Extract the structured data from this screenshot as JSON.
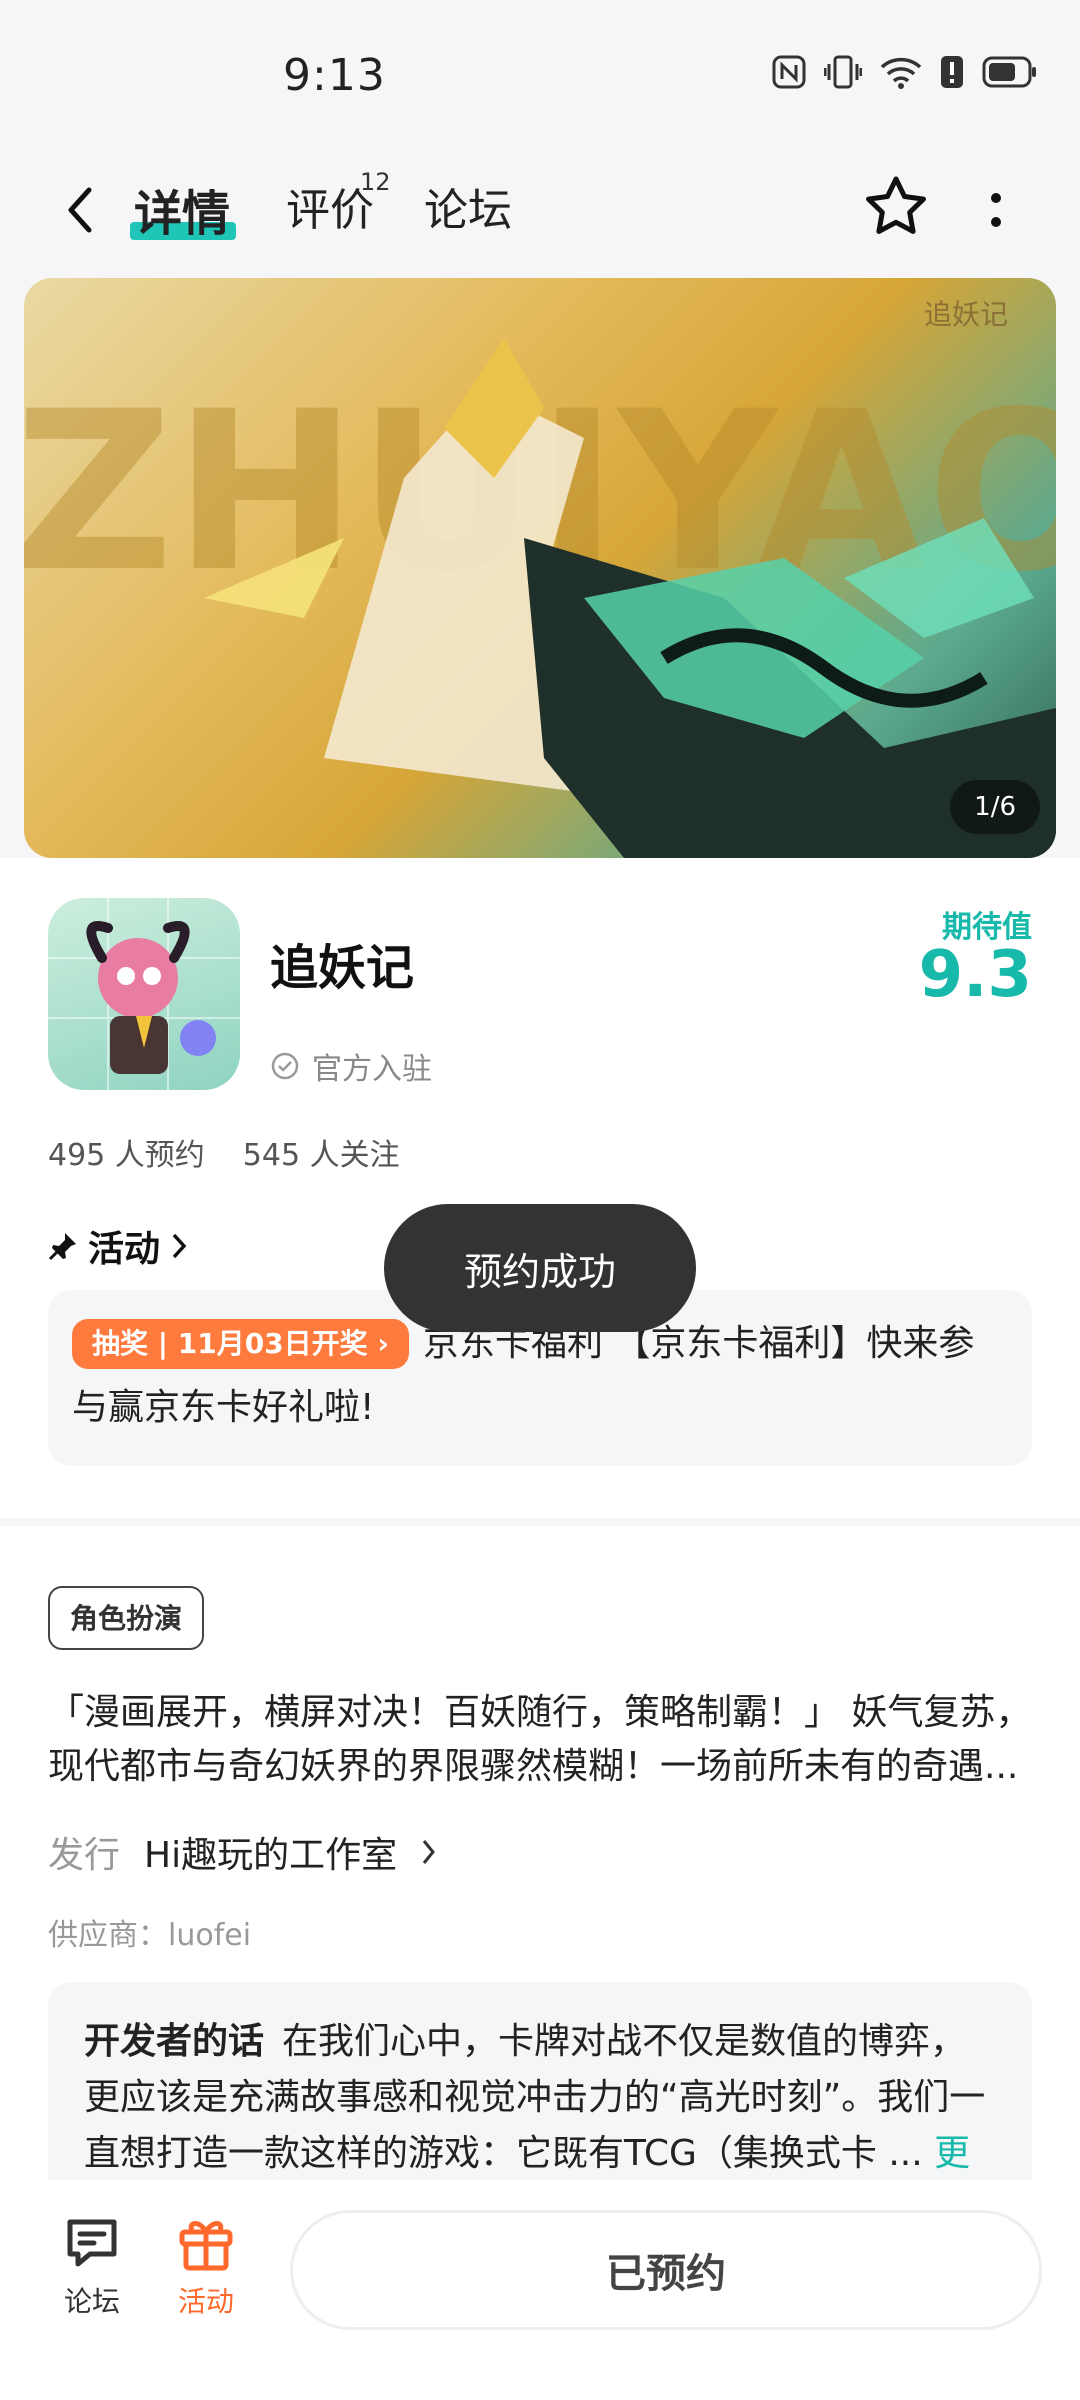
{
  "status_bar": {
    "time": "9:13"
  },
  "header": {
    "tabs": [
      {
        "label": "详情"
      },
      {
        "label": "评价",
        "badge": "12"
      },
      {
        "label": "论坛"
      }
    ]
  },
  "banner": {
    "counter": "1/6",
    "watermark": "ZHUIYAOJI",
    "corner_logo": "追妖记"
  },
  "app": {
    "name": "追妖记",
    "official_label": "官方入驻",
    "score_label": "期待值",
    "score": "9.3",
    "reservations": "495 人预约",
    "followers": "545 人关注"
  },
  "activity": {
    "heading": "活动",
    "tag": "抽奖 | 11月03日开奖",
    "text": "京东卡福利 【京东卡福利】快来参与赢京东卡好礼啦!"
  },
  "toast": {
    "text": "预约成功"
  },
  "details": {
    "genre": "角色扮演",
    "description_line1": "「漫画展开，横屏对决！百妖随行，策略制霸！」 妖气复苏，",
    "description_line2": "现代都市与奇幻妖界的界限骤然模糊！一场前所未有的奇遇...",
    "publisher_label": "发行",
    "publisher": "Hi趣玩的工作室",
    "supplier": "供应商：luofei",
    "dev_title": "开发者的话",
    "dev_text": "在我们心中，卡牌对战不仅是数值的博弈，更应该是充满故事感和视觉冲击力的“高光时刻”。我们一直想打造一款这样的游戏：它既有TCG（集换式卡 ...",
    "more": "更多"
  },
  "bottom_bar": {
    "forum_label": "论坛",
    "activity_label": "活动",
    "reserve_label": "已预约"
  },
  "colors": {
    "accent": "#16b9aa",
    "activity": "#ff6a2c",
    "tag": "#ff7a3d"
  }
}
